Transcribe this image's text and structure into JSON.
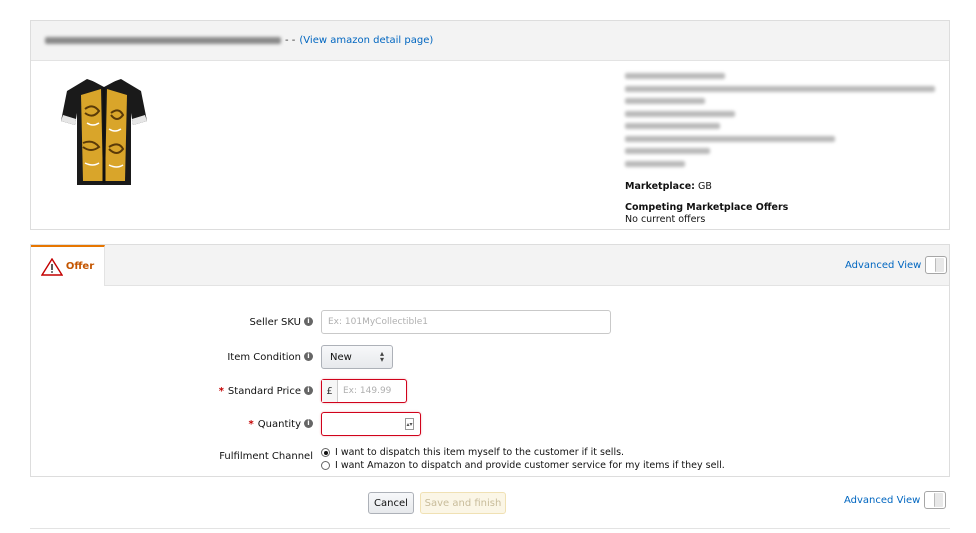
{
  "product": {
    "title_separator": "- -",
    "detail_link": "(View amazon detail page)",
    "marketplace_label": "Marketplace:",
    "marketplace_value": "GB",
    "competing_label": "Competing Marketplace Offers",
    "competing_value": "No current offers"
  },
  "offer": {
    "tab_label": "Offer",
    "advanced_view": "Advanced View",
    "fields": {
      "sku_label": "Seller SKU",
      "sku_placeholder": "Ex: 101MyCollectible1",
      "condition_label": "Item Condition",
      "condition_value": "New",
      "price_label": "Standard Price",
      "currency": "£",
      "price_placeholder": "Ex: 149.99",
      "quantity_label": "Quantity",
      "quantity_value": "",
      "fulfilment_label": "Fulfilment Channel",
      "fulfilment_options": [
        {
          "label": "I want to dispatch this item myself to the customer if it sells.",
          "selected": true
        },
        {
          "label": "I want Amazon to dispatch and provide customer service for my items if they sell.",
          "selected": false
        }
      ]
    }
  },
  "actions": {
    "cancel": "Cancel",
    "save": "Save and finish",
    "advanced_view": "Advanced View"
  },
  "colors": {
    "link": "#0066c0",
    "error": "#d0021b",
    "offer_tab": "#c45500"
  }
}
